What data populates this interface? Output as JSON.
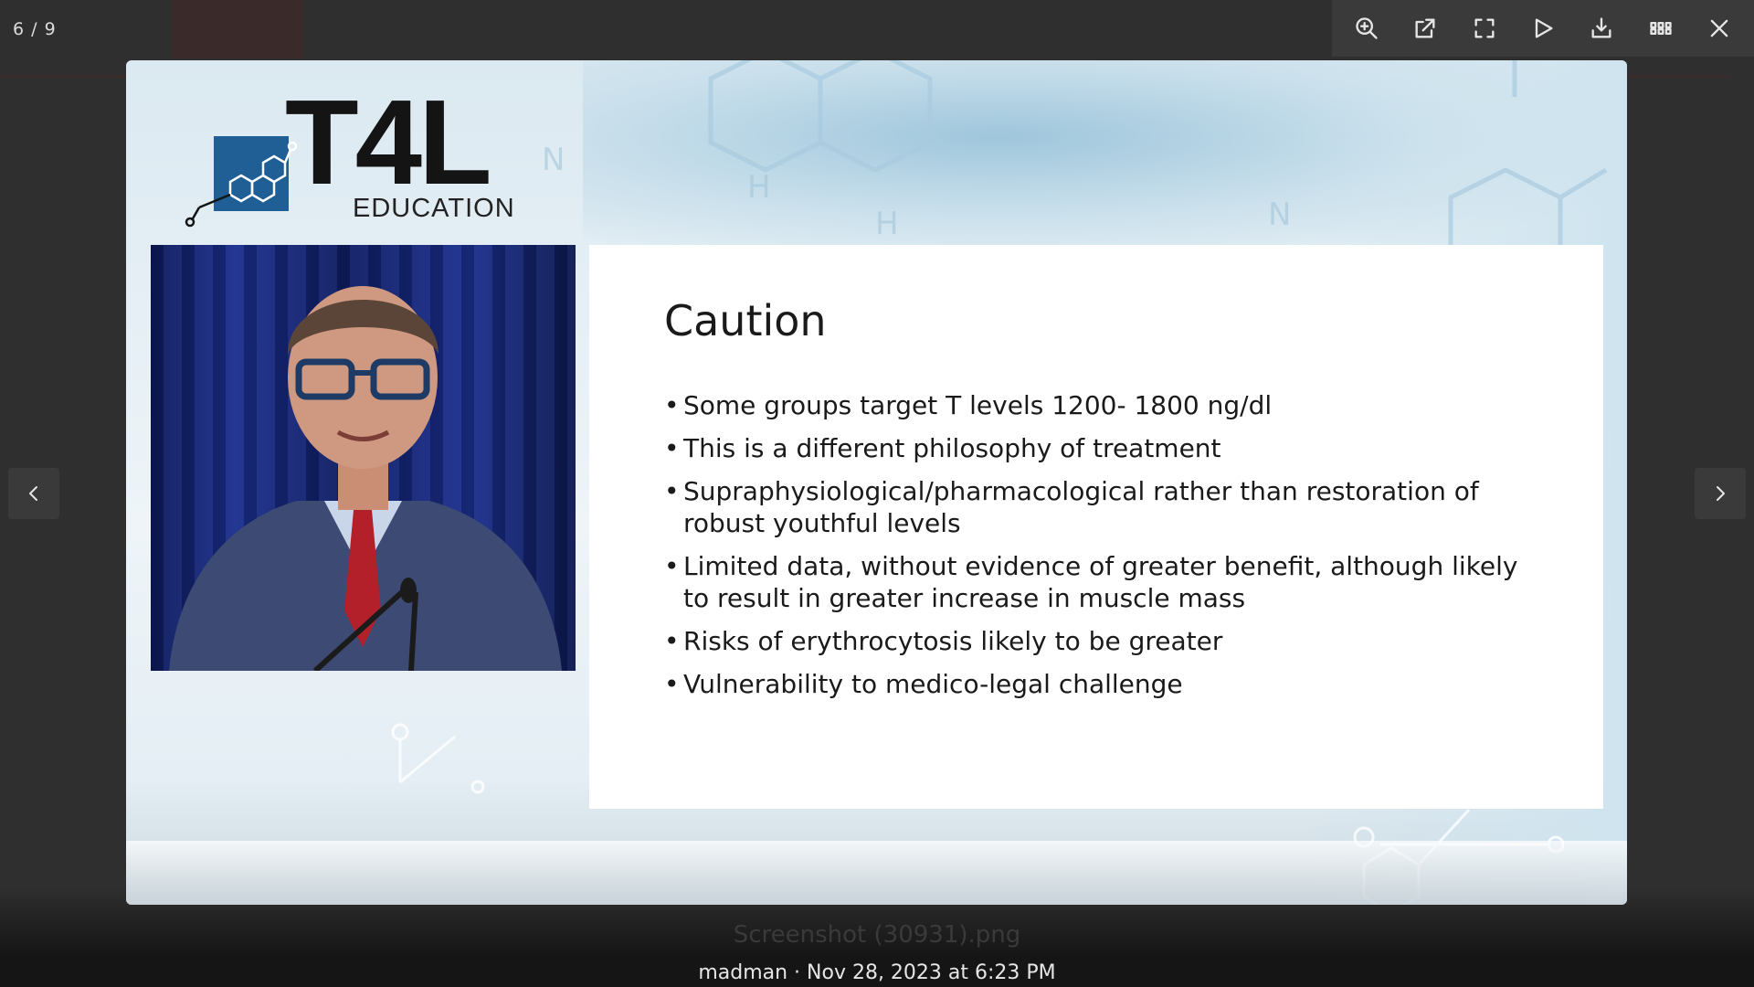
{
  "viewer": {
    "counter": "6 / 9",
    "toolbar": {
      "zoom": "zoom-in-icon",
      "open": "open-external-icon",
      "fullscreen": "fullscreen-icon",
      "play": "play-icon",
      "download": "download-icon",
      "grid": "grid-icon",
      "close": "close-icon"
    },
    "prev": "chevron-left-icon",
    "next": "chevron-right-icon",
    "background_filename": "Screenshot (30931).png",
    "caption": "madman · Nov 28, 2023 at 6:23 PM"
  },
  "slide": {
    "logo": {
      "main": "T4L",
      "sub": "EDUCATION"
    },
    "title": "Caution",
    "bullets": [
      "Some groups target T levels 1200- 1800 ng/dl",
      "This is a different philosophy of treatment",
      "Supraphysiological/pharmacological rather than restoration of robust youthful levels",
      "Limited data, without evidence of greater benefit, although likely to result in greater increase in muscle mass",
      "Risks of erythrocytosis likely to be greater",
      "Vulnerability to medico-legal challenge"
    ]
  },
  "colors": {
    "overlay": "#303030",
    "toolbar": "#3a3a3a",
    "logo_blue": "#1f5f96",
    "curtain_blue": "#1b2f8e"
  }
}
